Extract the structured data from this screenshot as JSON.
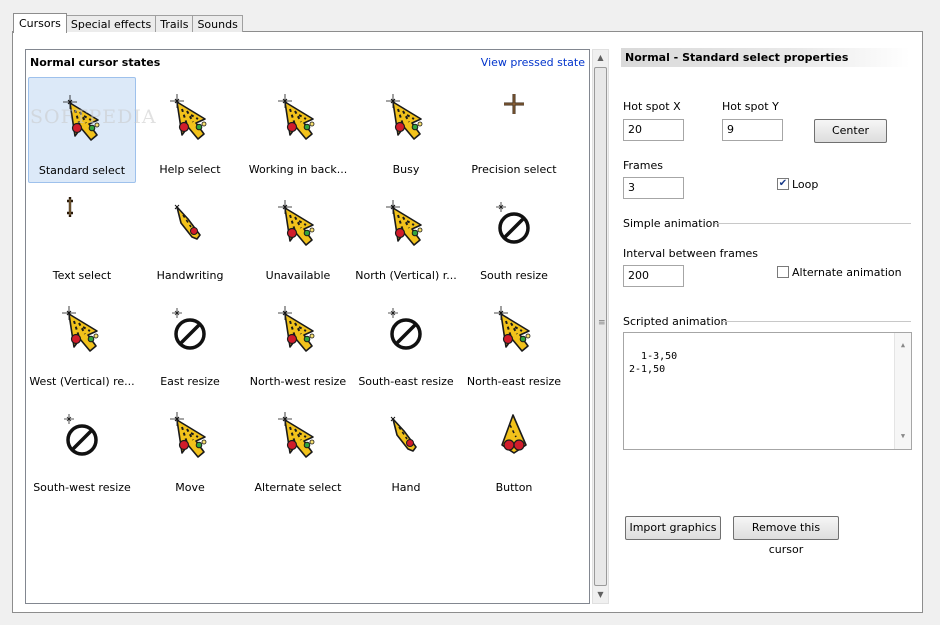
{
  "tabs": [
    {
      "label": "Cursors"
    },
    {
      "label": "Special effects"
    },
    {
      "label": "Trails"
    },
    {
      "label": "Sounds"
    }
  ],
  "list": {
    "title": "Normal cursor states",
    "view_link": "View pressed state",
    "watermark": "SOFTPEDIA",
    "items": [
      {
        "label": "Standard select",
        "icon": "arrow-cursor-icon"
      },
      {
        "label": "Help select",
        "icon": "arrow-cursor-icon"
      },
      {
        "label": "Working in back...",
        "icon": "arrow-cursor-icon"
      },
      {
        "label": "Busy",
        "icon": "arrow-cursor-icon"
      },
      {
        "label": "Precision select",
        "icon": "crosshair-icon"
      },
      {
        "label": "Text select",
        "icon": "text-beam-icon"
      },
      {
        "label": "Handwriting",
        "icon": "pen-cursor-icon"
      },
      {
        "label": "Unavailable",
        "icon": "arrow-cursor-icon"
      },
      {
        "label": "North (Vertical) r...",
        "icon": "arrow-cursor-icon"
      },
      {
        "label": "South resize",
        "icon": "no-symbol-icon"
      },
      {
        "label": "West (Vertical) re...",
        "icon": "arrow-cursor-icon"
      },
      {
        "label": "East resize",
        "icon": "no-symbol-icon"
      },
      {
        "label": "North-west resize",
        "icon": "arrow-cursor-icon"
      },
      {
        "label": "South-east resize",
        "icon": "no-symbol-icon"
      },
      {
        "label": "North-east resize",
        "icon": "arrow-cursor-icon"
      },
      {
        "label": "South-west resize",
        "icon": "no-symbol-icon"
      },
      {
        "label": "Move",
        "icon": "arrow-cursor-icon"
      },
      {
        "label": "Alternate select",
        "icon": "arrow-cursor-icon"
      },
      {
        "label": "Hand",
        "icon": "pen-cursor-icon"
      },
      {
        "label": "Button",
        "icon": "button-cursor-icon"
      }
    ]
  },
  "props": {
    "header": "Normal - Standard select properties",
    "hotspot_x_label": "Hot spot X",
    "hotspot_x_value": "20",
    "hotspot_y_label": "Hot spot Y",
    "hotspot_y_value": "9",
    "center_button": "Center",
    "frames_label": "Frames",
    "frames_value": "3",
    "loop_label": "Loop",
    "loop_checked": true,
    "simple_animation_label": "Simple animation",
    "interval_label": "Interval between frames",
    "interval_value": "200",
    "alternate_label": "Alternate animation",
    "alternate_checked": false,
    "scripted_label": "Scripted animation",
    "scripted_text": "1-3,50\n2-1,50",
    "import_button": "Import graphics",
    "remove_button": "Remove this cursor"
  }
}
